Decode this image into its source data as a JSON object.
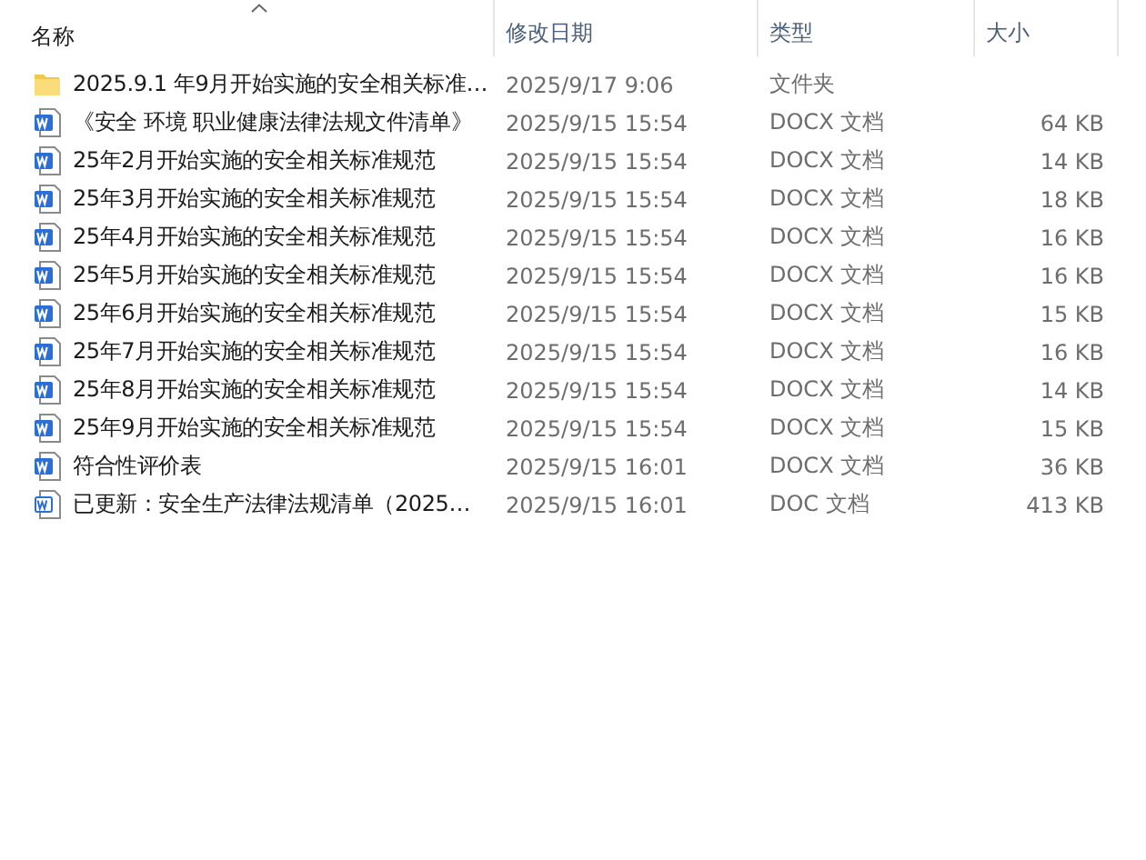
{
  "table": {
    "columns": [
      {
        "label": "名称",
        "sorted": true
      },
      {
        "label": "修改日期",
        "sorted": false
      },
      {
        "label": "类型",
        "sorted": false
      },
      {
        "label": "大小",
        "sorted": false
      }
    ],
    "rows": [
      {
        "kind": "folder",
        "name": "2025.9.1 年9月开始实施的安全相关标准…",
        "date": "2025/9/17 9:06",
        "type": "文件夹"
      },
      {
        "kind": "docx",
        "name": "《安全 环境 职业健康法律法规文件清单》",
        "date": "2025/9/15 15:54",
        "type": "DOCX 文档",
        "size": "64 KB"
      },
      {
        "kind": "docx",
        "name": "25年2月开始实施的安全相关标准规范",
        "date": "2025/9/15 15:54",
        "type": "DOCX 文档",
        "size": "14 KB"
      },
      {
        "kind": "docx",
        "name": "25年3月开始实施的安全相关标准规范",
        "date": "2025/9/15 15:54",
        "type": "DOCX 文档",
        "size": "18 KB"
      },
      {
        "kind": "docx",
        "name": "25年4月开始实施的安全相关标准规范",
        "date": "2025/9/15 15:54",
        "type": "DOCX 文档",
        "size": "16 KB"
      },
      {
        "kind": "docx",
        "name": "25年5月开始实施的安全相关标准规范",
        "date": "2025/9/15 15:54",
        "type": "DOCX 文档",
        "size": "16 KB"
      },
      {
        "kind": "docx",
        "name": "25年6月开始实施的安全相关标准规范",
        "date": "2025/9/15 15:54",
        "type": "DOCX 文档",
        "size": "15 KB"
      },
      {
        "kind": "docx",
        "name": "25年7月开始实施的安全相关标准规范",
        "date": "2025/9/15 15:54",
        "type": "DOCX 文档",
        "size": "16 KB"
      },
      {
        "kind": "docx",
        "name": "25年8月开始实施的安全相关标准规范",
        "date": "2025/9/15 15:54",
        "type": "DOCX 文档",
        "size": "14 KB"
      },
      {
        "kind": "docx",
        "name": "25年9月开始实施的安全相关标准规范",
        "date": "2025/9/15 15:54",
        "type": "DOCX 文档",
        "size": "15 KB"
      },
      {
        "kind": "docx",
        "name": "符合性评价表",
        "date": "2025/9/15 16:01",
        "type": "DOCX 文档",
        "size": "36 KB"
      },
      {
        "kind": "doc",
        "name": "已更新：安全生产法律法规清单（2025…",
        "date": "2025/9/15 16:01",
        "type": "DOC 文档",
        "size": "413 KB"
      }
    ]
  }
}
